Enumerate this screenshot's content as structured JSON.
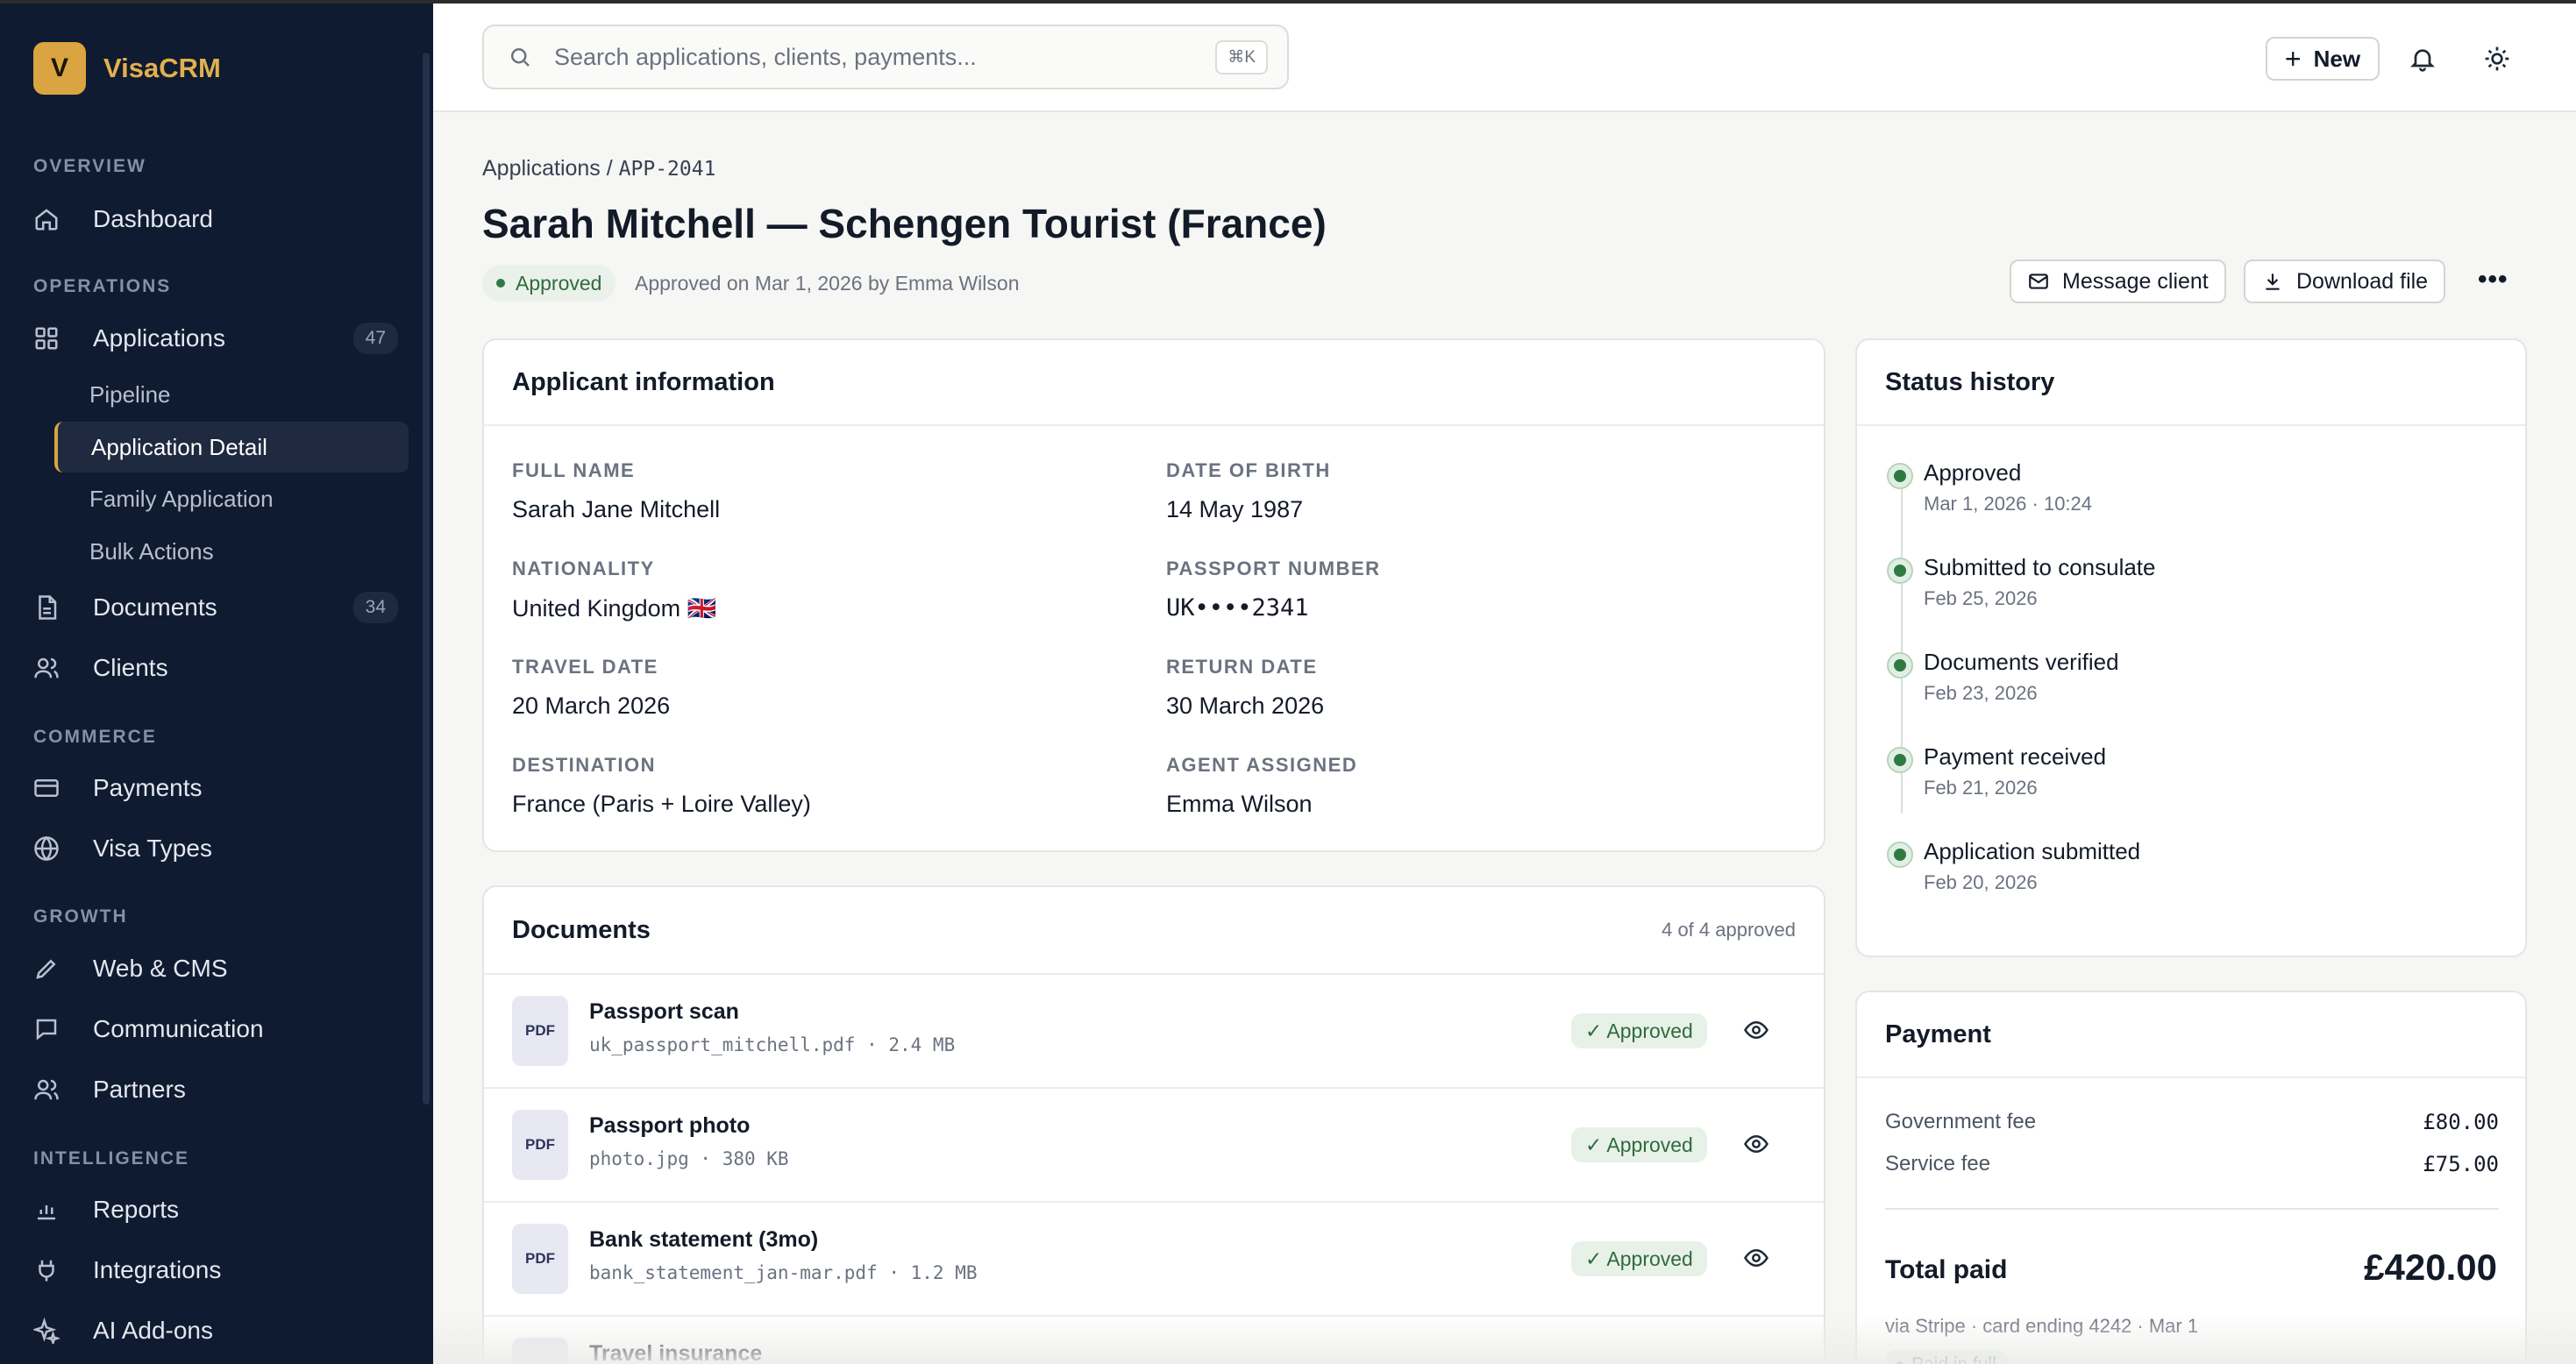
{
  "app": {
    "logo_letter": "V",
    "name": "VisaCRM",
    "accent": "#d9a441",
    "sidebar_bg": "#0f1b30"
  },
  "sidebar": {
    "sections": {
      "overview": "OVERVIEW",
      "operations": "OPERATIONS",
      "commerce": "COMMERCE",
      "growth": "GROWTH",
      "intelligence": "INTELLIGENCE"
    },
    "items": {
      "dashboard": {
        "label": "Dashboard",
        "icon": "home-icon"
      },
      "applications": {
        "label": "Applications",
        "icon": "grid-icon",
        "count": "47"
      },
      "pipeline": {
        "label": "Pipeline"
      },
      "application_detail": {
        "label": "Application Detail",
        "active": true
      },
      "family_application": {
        "label": "Family Application"
      },
      "bulk_actions": {
        "label": "Bulk Actions"
      },
      "documents": {
        "label": "Documents",
        "icon": "document-icon",
        "count": "34"
      },
      "clients": {
        "label": "Clients",
        "icon": "users-icon"
      },
      "payments": {
        "label": "Payments",
        "icon": "credit-card-icon"
      },
      "visa_types": {
        "label": "Visa Types",
        "icon": "globe-icon"
      },
      "web_cms": {
        "label": "Web & CMS",
        "icon": "pencil-icon"
      },
      "communication": {
        "label": "Communication",
        "icon": "chat-icon"
      },
      "partners": {
        "label": "Partners",
        "icon": "users-icon"
      },
      "reports": {
        "label": "Reports",
        "icon": "bar-chart-icon"
      },
      "integrations": {
        "label": "Integrations",
        "icon": "plug-icon"
      },
      "ai_addons": {
        "label": "AI Add-ons",
        "icon": "sparkle-icon"
      }
    }
  },
  "topbar": {
    "search_placeholder": "Search applications, clients, payments...",
    "search_shortcut": "⌘K",
    "new_label": "New"
  },
  "header": {
    "breadcrumb_root": "Applications",
    "breadcrumb_sep": "/",
    "breadcrumb_id": "APP-2041",
    "title": "Sarah Mitchell — Schengen Tourist (France)",
    "status": "Approved",
    "status_note": "Approved on Mar 1, 2026 by Emma Wilson",
    "message_client": "Message client",
    "download_file": "Download file",
    "more": "•••"
  },
  "applicant": {
    "title": "Applicant information",
    "fields": [
      {
        "label": "FULL NAME",
        "value": "Sarah Jane Mitchell"
      },
      {
        "label": "DATE OF BIRTH",
        "value": "14 May 1987"
      },
      {
        "label": "NATIONALITY",
        "value": "United Kingdom 🇬🇧"
      },
      {
        "label": "PASSPORT NUMBER",
        "value": "UK••••2341"
      },
      {
        "label": "TRAVEL DATE",
        "value": "20 March 2026"
      },
      {
        "label": "RETURN DATE",
        "value": "30 March 2026"
      },
      {
        "label": "DESTINATION",
        "value": "France (Paris + Loire Valley)"
      },
      {
        "label": "AGENT ASSIGNED",
        "value": "Emma Wilson"
      }
    ]
  },
  "documents": {
    "title": "Documents",
    "summary": "4 of 4 approved",
    "items": [
      {
        "type": "PDF",
        "name": "Passport scan",
        "meta": "uk_passport_mitchell.pdf · 2.4 MB",
        "status": "✓ Approved"
      },
      {
        "type": "PDF",
        "name": "Passport photo",
        "meta": "photo.jpg · 380 KB",
        "status": "✓ Approved"
      },
      {
        "type": "PDF",
        "name": "Bank statement (3mo)",
        "meta": "bank_statement_jan-mar.pdf · 1.2 MB",
        "status": "✓ Approved"
      },
      {
        "type": "",
        "name": "Travel insurance",
        "meta": "",
        "status": ""
      }
    ]
  },
  "status_history": {
    "title": "Status history",
    "items": [
      {
        "title": "Approved",
        "date": "Mar 1, 2026 · 10:24"
      },
      {
        "title": "Submitted to consulate",
        "date": "Feb 25, 2026"
      },
      {
        "title": "Documents verified",
        "date": "Feb 23, 2026"
      },
      {
        "title": "Payment received",
        "date": "Feb 21, 2026"
      },
      {
        "title": "Application submitted",
        "date": "Feb 20, 2026"
      }
    ]
  },
  "payment": {
    "title": "Payment",
    "lines": [
      {
        "label": "Government fee",
        "amount": "£80.00"
      },
      {
        "label": "Service fee",
        "amount": "£75.00"
      }
    ],
    "total_label": "Total paid",
    "total_amount": "£420.00",
    "via": "via Stripe · card ending 4242 · Mar 1",
    "badge": "Paid in full"
  }
}
